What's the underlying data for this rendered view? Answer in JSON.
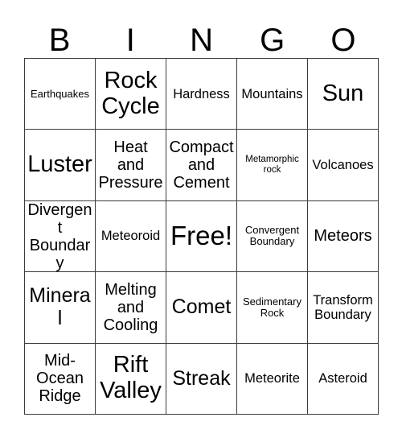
{
  "card": {
    "header_letters": [
      "B",
      "I",
      "N",
      "G",
      "O"
    ],
    "free_space_label": "Free!",
    "border_color": "#3c3c3c",
    "background_color": "#ffffff",
    "text_color": "#000000",
    "rows": [
      [
        {
          "label": "Earthquakes",
          "size": "sm"
        },
        {
          "label": "Rock Cycle",
          "size": "xxl"
        },
        {
          "label": "Hardness",
          "size": "md"
        },
        {
          "label": "Mountains",
          "size": "md"
        },
        {
          "label": "Sun",
          "size": "xxl"
        }
      ],
      [
        {
          "label": "Luster",
          "size": "xxl"
        },
        {
          "label": "Heat and Pressure",
          "size": "lg"
        },
        {
          "label": "Compact and Cement",
          "size": "lg"
        },
        {
          "label": "Metamorphic rock",
          "size": "xs"
        },
        {
          "label": "Volcanoes",
          "size": "md"
        }
      ],
      [
        {
          "label": "Divergent Boundary",
          "size": "lg"
        },
        {
          "label": "Meteoroid",
          "size": "md"
        },
        {
          "label": "Free!",
          "size": "free"
        },
        {
          "label": "Convergent Boundary",
          "size": "sm"
        },
        {
          "label": "Meteors",
          "size": "lg"
        }
      ],
      [
        {
          "label": "Mineral",
          "size": "xl"
        },
        {
          "label": "Melting and Cooling",
          "size": "lg"
        },
        {
          "label": "Comet",
          "size": "xl"
        },
        {
          "label": "Sedimentary Rock",
          "size": "sm"
        },
        {
          "label": "Transform Boundary",
          "size": "md"
        }
      ],
      [
        {
          "label": "Mid-Ocean Ridge",
          "size": "lg"
        },
        {
          "label": "Rift Valley",
          "size": "xxl"
        },
        {
          "label": "Streak",
          "size": "xl"
        },
        {
          "label": "Meteorite",
          "size": "md"
        },
        {
          "label": "Asteroid",
          "size": "md"
        }
      ]
    ]
  }
}
